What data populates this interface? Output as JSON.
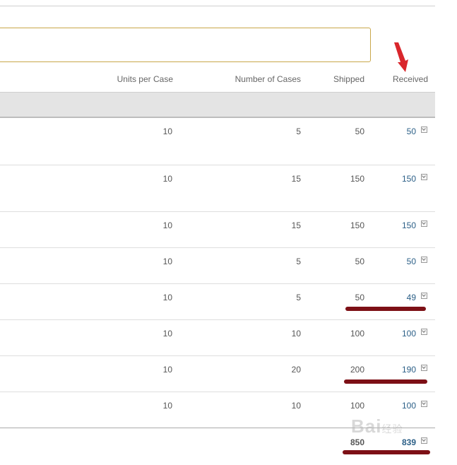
{
  "columns": {
    "units_per_case": "Units per Case",
    "number_of_cases": "Number of Cases",
    "shipped": "Shipped",
    "received": "Received"
  },
  "rows": [
    {
      "units": "10",
      "cases": "5",
      "shipped": "50",
      "received": "50"
    },
    {
      "units": "10",
      "cases": "15",
      "shipped": "150",
      "received": "150"
    },
    {
      "units": "10",
      "cases": "15",
      "shipped": "150",
      "received": "150"
    },
    {
      "units": "10",
      "cases": "5",
      "shipped": "50",
      "received": "50"
    },
    {
      "units": "10",
      "cases": "5",
      "shipped": "50",
      "received": "49"
    },
    {
      "units": "10",
      "cases": "10",
      "shipped": "100",
      "received": "100"
    },
    {
      "units": "10",
      "cases": "20",
      "shipped": "200",
      "received": "190"
    },
    {
      "units": "10",
      "cases": "10",
      "shipped": "100",
      "received": "100"
    }
  ],
  "totals": {
    "shipped": "850",
    "received": "839"
  },
  "watermark": {
    "text": "Bai",
    "sub": "经验"
  },
  "colors": {
    "received_link": "#2b5f87",
    "annotation": "#7d1016",
    "arrow": "#d9262c",
    "search_border": "#c9a74a"
  }
}
